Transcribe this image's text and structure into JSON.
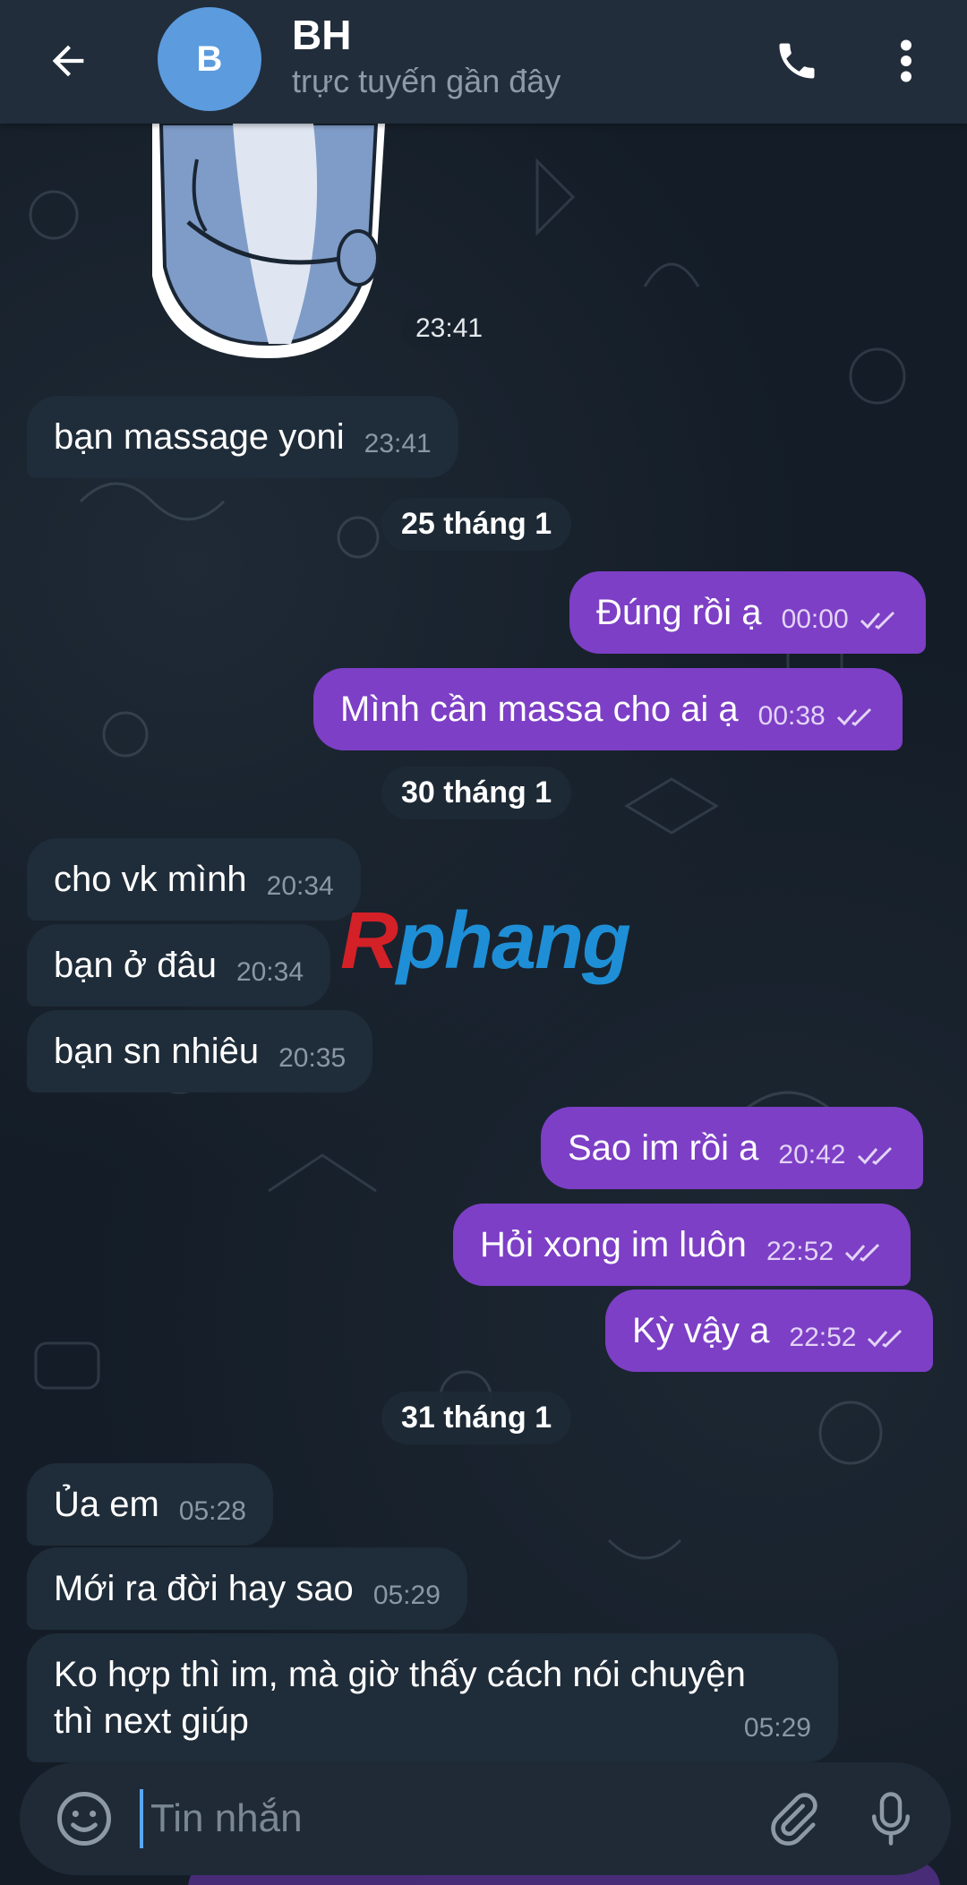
{
  "header": {
    "back_icon": "arrow-left-icon",
    "avatar_initial": "B",
    "contact_name": "BH",
    "status": "trực tuyến gần đây",
    "call_icon": "phone-icon",
    "menu_icon": "more-vertical-icon"
  },
  "sticker": {
    "time": "23:41"
  },
  "messages": [
    {
      "text": "bạn massage yoni",
      "time": "23:41"
    },
    {
      "date": "25 tháng 1"
    },
    {
      "text": "Đúng rồi ạ",
      "time": "00:00"
    },
    {
      "text": "Mình cần massa cho ai ạ",
      "time": "00:38"
    },
    {
      "date": "30 tháng 1"
    },
    {
      "text": "cho vk mình",
      "time": "20:34"
    },
    {
      "text": "bạn ở đâu",
      "time": "20:34"
    },
    {
      "text": "bạn sn nhiêu",
      "time": "20:35"
    },
    {
      "text": "Sao im rồi a",
      "time": "20:42"
    },
    {
      "text": "Hỏi xong im luôn",
      "time": "22:52"
    },
    {
      "text": "Kỳ vậy a",
      "time": "22:52"
    },
    {
      "date": "31 tháng 1"
    },
    {
      "text": "Ủa em",
      "time": "05:28"
    },
    {
      "text": "Mới ra đời hay sao",
      "time": "05:29"
    },
    {
      "text_line1": "Ko hợp thì im, mà giờ thấy cách nói chuyện",
      "text_line2": "thì next giúp",
      "time": "05:29"
    }
  ],
  "watermark": {
    "first": "R",
    "rest": "phang"
  },
  "composer": {
    "placeholder": "Tin nhắn",
    "emoji_icon": "smile-icon",
    "attach_icon": "paperclip-icon",
    "mic_icon": "microphone-icon"
  },
  "colors": {
    "header_bg": "#212d3b",
    "incoming_bubble": "#1f2c39",
    "outgoing_bubble": "#7d3fc6",
    "avatar": "#5b9bde"
  }
}
